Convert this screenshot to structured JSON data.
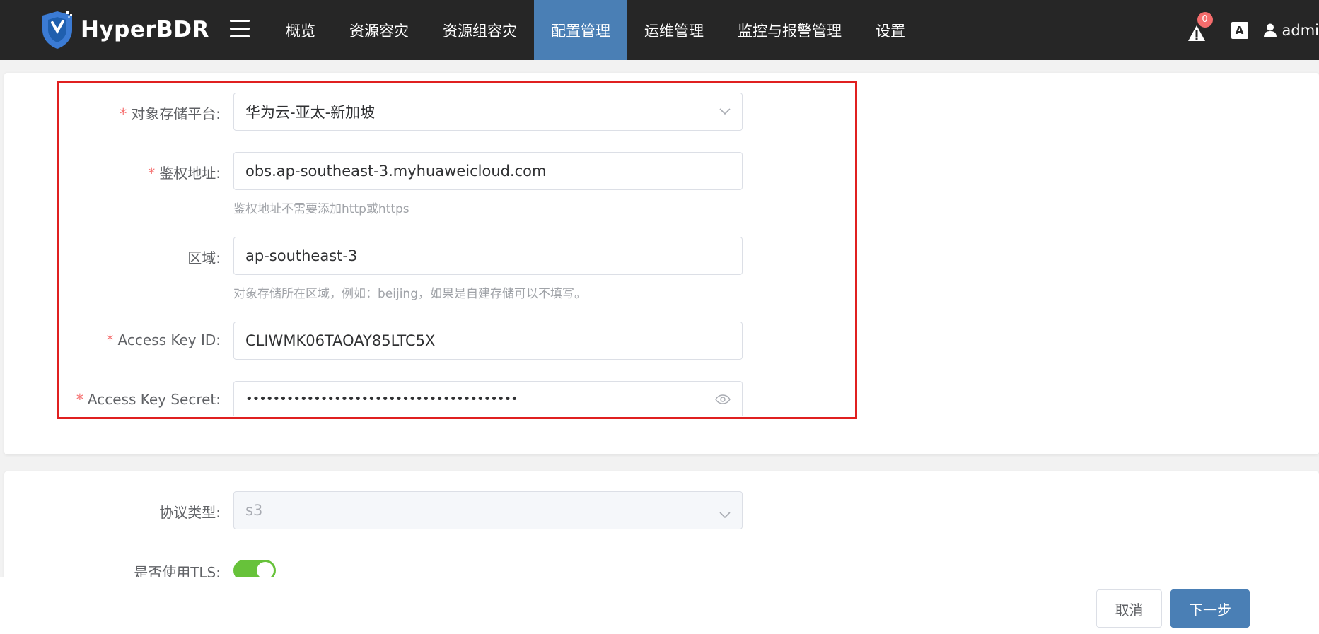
{
  "header": {
    "brand": "HyperBDR",
    "nav": [
      {
        "label": "概览"
      },
      {
        "label": "资源容灾"
      },
      {
        "label": "资源组容灾"
      },
      {
        "label": "配置管理",
        "active": true
      },
      {
        "label": "运维管理"
      },
      {
        "label": "监控与报警管理"
      },
      {
        "label": "设置"
      }
    ],
    "alert_count": "0",
    "lang_icon": "A",
    "user": "admi"
  },
  "form": {
    "platform": {
      "label": "对象存储平台:",
      "required": "*",
      "value": "华为云-亚太-新加坡"
    },
    "endpoint": {
      "label": "鉴权地址:",
      "required": "*",
      "value": "obs.ap-southeast-3.myhuaweicloud.com",
      "hint": "鉴权地址不需要添加http或https"
    },
    "region": {
      "label": "区域:",
      "value": "ap-southeast-3",
      "hint": "对象存储所在区域，例如：beijing，如果是自建存储可以不填写。"
    },
    "access_key_id": {
      "label": "Access Key ID:",
      "required": "*",
      "value": "CLIWMK06TAOAY85LTC5X"
    },
    "access_key_secret": {
      "label": "Access Key Secret:",
      "required": "*",
      "value": "••••••••••••••••••••••••••••••••••••••••"
    },
    "protocol": {
      "label": "协议类型:",
      "value": "s3"
    },
    "tls": {
      "label": "是否使用TLS:",
      "enabled": true
    }
  },
  "footer": {
    "cancel": "取消",
    "next": "下一步"
  },
  "colors": {
    "topbar": "#262626",
    "active_nav": "#4a7fb5",
    "highlight_border": "#e02020",
    "toggle_on": "#67c23a",
    "required": "#f56c6c"
  }
}
